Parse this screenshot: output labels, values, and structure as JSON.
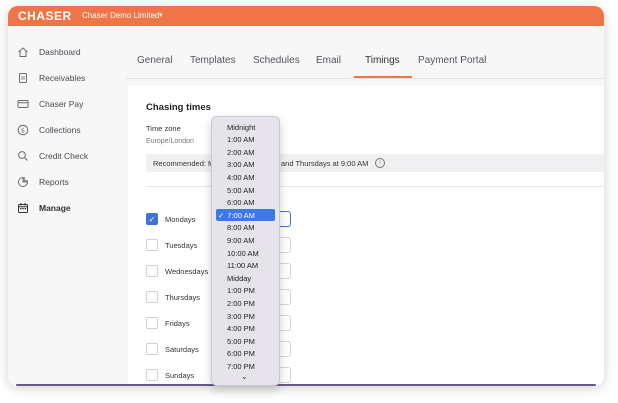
{
  "header": {
    "logo": "CHASER",
    "org": "Chaser Demo Limited",
    "caret": "▾"
  },
  "sidebar": {
    "items": [
      {
        "label": "Dashboard",
        "icon": "home-icon"
      },
      {
        "label": "Receivables",
        "icon": "document-icon"
      },
      {
        "label": "Chaser Pay",
        "icon": "card-icon"
      },
      {
        "label": "Collections",
        "icon": "dollar-circle-icon"
      },
      {
        "label": "Credit Check",
        "icon": "search-icon"
      },
      {
        "label": "Reports",
        "icon": "pie-chart-icon"
      },
      {
        "label": "Manage",
        "icon": "calendar-icon",
        "active": true
      }
    ]
  },
  "tabs": [
    {
      "label": "General"
    },
    {
      "label": "Templates"
    },
    {
      "label": "Schedules"
    },
    {
      "label": "Email"
    },
    {
      "label": "Timings",
      "active": true
    },
    {
      "label": "Payment Portal"
    }
  ],
  "chasing": {
    "title": "Chasing times",
    "timezone_label": "Time zone",
    "timezone_value": "Europe/London",
    "recommended_left": "Recommended: M",
    "recommended_right": "and Thursdays at 9:00 AM",
    "info_glyph": "i"
  },
  "days": [
    {
      "label": "Mondays",
      "checked": true
    },
    {
      "label": "Tuesdays",
      "checked": false
    },
    {
      "label": "Wednesdays",
      "checked": false
    },
    {
      "label": "Thursdays",
      "checked": false
    },
    {
      "label": "Fridays",
      "checked": false
    },
    {
      "label": "Saturdays",
      "checked": false
    },
    {
      "label": "Sundays",
      "checked": false
    }
  ],
  "dropdown": {
    "options": [
      "Midnight",
      "1:00 AM",
      "2:00 AM",
      "3:00 AM",
      "4:00 AM",
      "5:00 AM",
      "6:00 AM",
      "7:00 AM",
      "8:00 AM",
      "9:00 AM",
      "10:00 AM",
      "11:00 AM",
      "Midday",
      "1:00 PM",
      "2:00 PM",
      "3:00 PM",
      "4:00 PM",
      "5:00 PM",
      "6:00 PM",
      "7:00 PM"
    ],
    "selected": "7:00 AM",
    "check_glyph": "✓",
    "more_glyph": "⌄"
  },
  "colors": {
    "brand": "#ef7447",
    "accent": "#3f73d8",
    "selection": "#3d79e6"
  }
}
